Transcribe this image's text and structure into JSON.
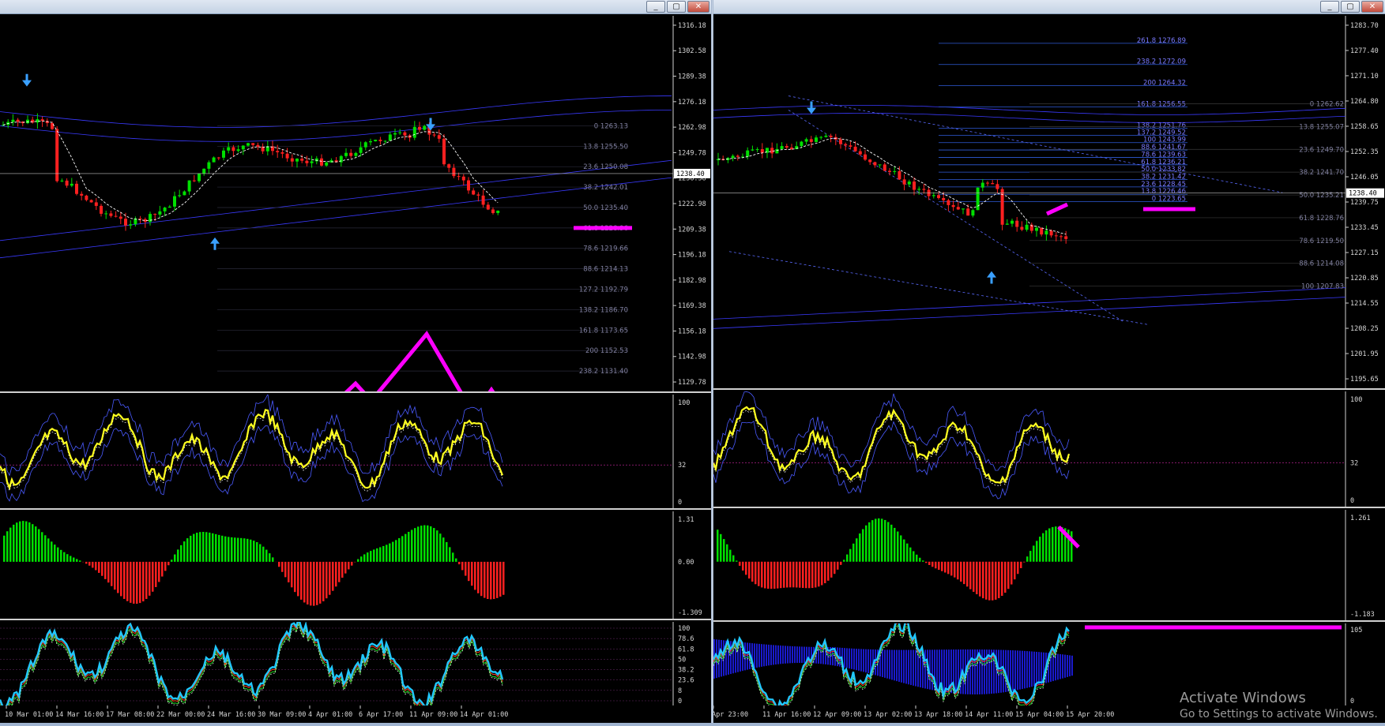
{
  "left_window": {
    "title_buttons": [
      "_",
      "▢",
      "✕"
    ],
    "price_axis": [
      "1316.18",
      "1302.58",
      "1289.38",
      "1276.18",
      "1262.98",
      "1249.78",
      "1236.58",
      "1222.98",
      "1209.38",
      "1196.18",
      "1182.98",
      "1169.38",
      "1156.18",
      "1142.98",
      "1129.78"
    ],
    "current_price": "1238.40",
    "fib_levels": [
      "0 1263.13",
      "13.8 1255.50",
      "23.6 1250.08",
      "38.2 1242.01",
      "50.0 1235.40",
      "61.8 1228.96",
      "78.6 1219.66",
      "88.6 1214.13",
      "127.2 1192.79",
      "138.2 1186.70",
      "161.8 1173.65",
      "200 1152.53",
      "238.2 1131.40"
    ],
    "osc1_axis": [
      "100",
      "32",
      "0"
    ],
    "osc2_axis": [
      "1.31",
      "0.00",
      "-1.309"
    ],
    "osc3_axis": [
      "100",
      "78.6",
      "61.8",
      "50",
      "38.2",
      "23.6",
      "8",
      "0"
    ],
    "time_axis": [
      "10 Mar 01:00",
      "14 Mar 16:00",
      "17 Mar 08:00",
      "22 Mar 00:00",
      "24 Mar 16:00",
      "30 Mar 09:00",
      "4 Apr 01:00",
      "6 Apr 17:00",
      "11 Apr 09:00",
      "14 Apr 01:00"
    ]
  },
  "right_window": {
    "title_buttons": [
      "_",
      "▢",
      "✕"
    ],
    "price_axis": [
      "1283.70",
      "1277.40",
      "1271.10",
      "1264.80",
      "1258.65",
      "1252.35",
      "1246.05",
      "1239.75",
      "1233.45",
      "1227.15",
      "1220.85",
      "1214.55",
      "1208.25",
      "1201.95",
      "1195.65"
    ],
    "current_price": "1238.40",
    "fib_up": [
      "261.8 1276.89",
      "238.2 1272.09",
      "200 1264.32",
      "161.8 1256.55",
      "138.2 1251.76",
      "137.2 1249.52",
      "100 1243.99",
      "88.6 1241.67",
      "78.6 1239.63",
      "61.8 1236.21",
      "50.0 1233.82",
      "38.2 1231.42",
      "23.6 1228.45",
      "13.8 1226.46",
      "0 1223.65"
    ],
    "fib_down": [
      "0 1262.62",
      "13.8 1255.07",
      "23.6 1249.70",
      "38.2 1241.70",
      "50.0 1235.21",
      "61.8 1228.76",
      "78.6 1219.50",
      "88.6 1214.08",
      "100 1207.83"
    ],
    "osc1_axis": [
      "100",
      "32",
      "0"
    ],
    "osc2_axis": [
      "1.261",
      "-1.183"
    ],
    "osc3_axis": [
      "105",
      "0"
    ],
    "time_axis": [
      "Apr 23:00",
      "11 Apr 16:00",
      "12 Apr 09:00",
      "13 Apr 02:00",
      "13 Apr 18:00",
      "14 Apr 11:00",
      "15 Apr 04:00",
      "15 Apr 20:00"
    ]
  },
  "watermark": {
    "line1": "Activate Windows",
    "line2": "Go to Settings to activate Windows."
  },
  "colors": {
    "bull": "#00e000",
    "bear": "#ff2020",
    "osc_main": "#ffff20",
    "band": "#3a3aff",
    "stoch": "#20c8ff",
    "annotation": "#ff00ff"
  }
}
